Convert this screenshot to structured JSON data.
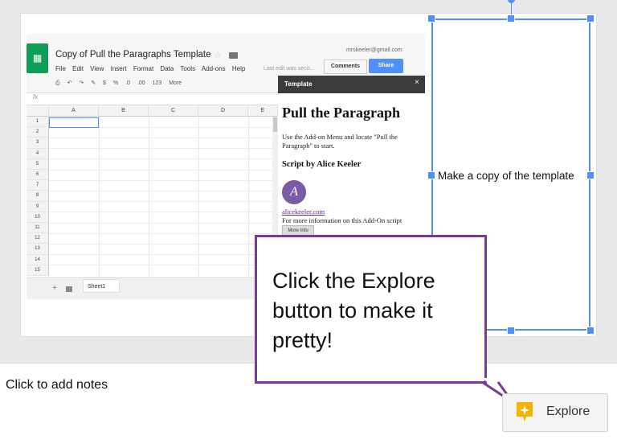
{
  "sheet": {
    "doc_title": "Copy of Pull the Paragraphs Template",
    "account": "mrskeeler@gmail.com",
    "last_edit": "Last edit was seco...",
    "comments": "Comments",
    "share": "Share",
    "menus": [
      "File",
      "Edit",
      "View",
      "Insert",
      "Format",
      "Data",
      "Tools",
      "Add-ons",
      "Help"
    ],
    "toolbar": [
      "$",
      "%",
      ".0",
      ".00",
      "123",
      "More"
    ],
    "fx": "fx",
    "columns": [
      "A",
      "B",
      "C",
      "D",
      "E"
    ],
    "rows": [
      "1",
      "2",
      "3",
      "4",
      "5",
      "6",
      "7",
      "8",
      "9",
      "10",
      "11",
      "12",
      "13",
      "14",
      "15"
    ],
    "sheet_tab": "Sheet1"
  },
  "panel": {
    "header": "Template",
    "close": "×",
    "heading": "Pull the Paragraph",
    "instructions": "Use the Add-on Menu and locate \"Pull the Paragraph\" to start.",
    "script_by": "Script by Alice Keeler",
    "link": "alicekeeler.com",
    "more_text": "For more information on this Add-On script",
    "more_button": "More Info"
  },
  "textbox": {
    "text": "Make a copy of the template"
  },
  "callout": {
    "text": "Click the Explore button to make it pretty!"
  },
  "notes": {
    "placeholder": "Click to add notes"
  },
  "explore": {
    "label": "Explore",
    "icon": "explore-spark-icon",
    "icon_color": "#f4b400"
  },
  "colors": {
    "selection": "#4d90fe",
    "callout_border": "#7a3a9a",
    "sheets_green": "#0f9d58"
  }
}
